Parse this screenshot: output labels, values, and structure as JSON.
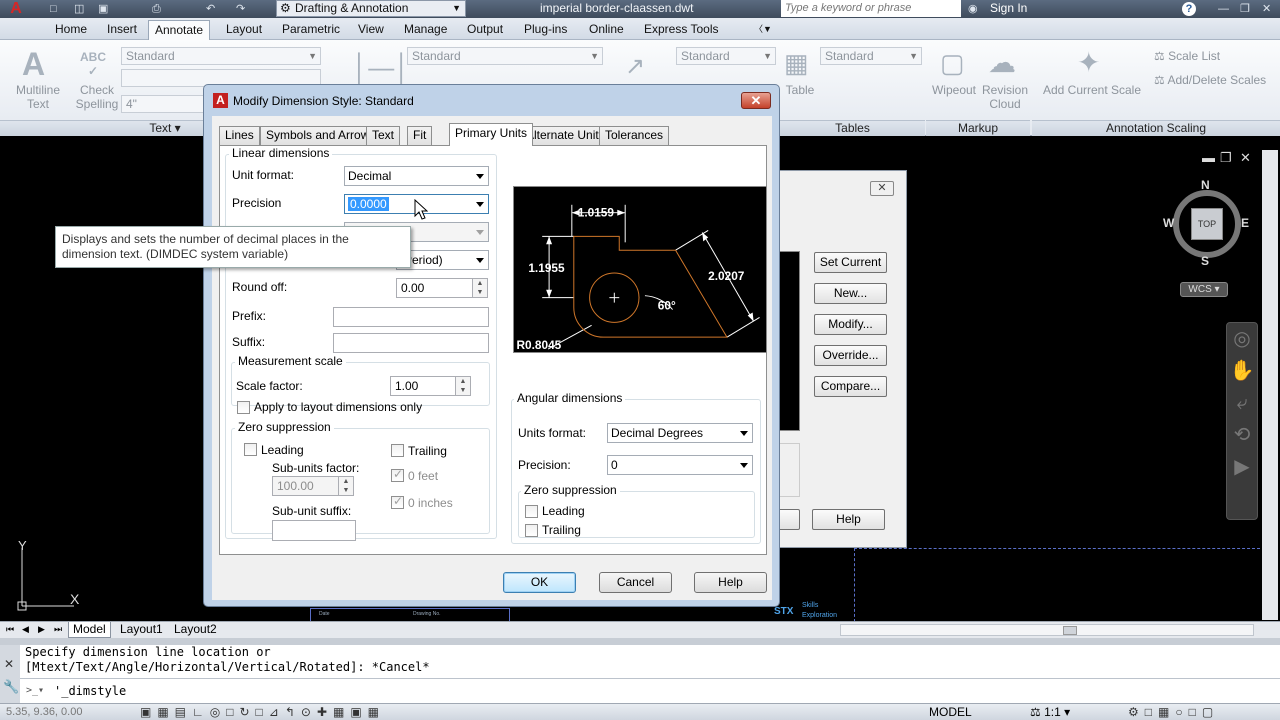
{
  "app": {
    "workspace": "Drafting & Annotation",
    "document_title": "imperial border-claassen.dwt",
    "search_placeholder": "Type a keyword or phrase",
    "sign_in": "Sign In",
    "help_icon": "?"
  },
  "ribbon": {
    "tabs": [
      "Home",
      "Insert",
      "Annotate",
      "Layout",
      "Parametric",
      "View",
      "Manage",
      "Output",
      "Plug-ins",
      "Online",
      "Express Tools"
    ],
    "active_tab": "Annotate",
    "text_panel": {
      "multiline_text": "Multiline Text",
      "check_spelling": "Check Spelling",
      "style_combo": "Standard",
      "height_combo": "4\"",
      "panel_label": "Text"
    },
    "dim_style_combo": "Standard",
    "table_style_combo": "Standard",
    "table_label": "Table",
    "multileader_combo": "Standard",
    "tables_panel": "Tables",
    "wipeout": "Wipeout",
    "revision_cloud": "Revision Cloud",
    "markup_panel": "Markup",
    "add_current_scale": "Add Current Scale",
    "scale_list": "Scale List",
    "add_delete_scales": "Add/Delete Scales",
    "annotation_scaling_panel": "Annotation Scaling"
  },
  "viewcube": {
    "top": "TOP",
    "n": "N",
    "s": "S",
    "e": "E",
    "w": "W",
    "wcs": "WCS"
  },
  "bg_dialog": {
    "buttons": [
      "Set Current",
      "New...",
      "Modify...",
      "Override...",
      "Compare..."
    ],
    "help": "Help"
  },
  "dialog": {
    "title": "Modify Dimension Style: Standard",
    "tabs": [
      "Lines",
      "Symbols and Arrows",
      "Text",
      "Fit",
      "Primary Units",
      "Alternate Units",
      "Tolerances"
    ],
    "active_tab": "Primary Units",
    "linear": {
      "group": "Linear dimensions",
      "unit_format_label": "Unit format:",
      "unit_format": "Decimal",
      "precision_label": "Precision",
      "precision": "0.0000",
      "decimal_sep_partial": "(Period)",
      "round_off_label": "Round off:",
      "round_off": "0.00",
      "prefix_label": "Prefix:",
      "suffix_label": "Suffix:"
    },
    "measurement": {
      "group": "Measurement scale",
      "scale_factor_label": "Scale factor:",
      "scale_factor": "1.00",
      "apply_layout": "Apply to layout dimensions only"
    },
    "zero": {
      "group": "Zero suppression",
      "leading": "Leading",
      "trailing": "Trailing",
      "sub_units_factor_label": "Sub-units factor:",
      "sub_units_factor": "100.00",
      "feet": "0 feet",
      "inches": "0 inches",
      "sub_unit_suffix_label": "Sub-unit suffix:"
    },
    "preview": {
      "dim_top": "1.0159",
      "dim_left": "1.1955",
      "dim_right": "2.0207",
      "angle": "60°",
      "radius": "R0.8045"
    },
    "angular": {
      "group": "Angular dimensions",
      "units_format_label": "Units format:",
      "units_format": "Decimal Degrees",
      "precision_label": "Precision:",
      "precision": "0",
      "zero_group": "Zero suppression",
      "leading": "Leading",
      "trailing": "Trailing"
    },
    "ok": "OK",
    "cancel": "Cancel",
    "help": "Help"
  },
  "tooltip": {
    "text": "Displays and sets the number of decimal places in the dimension text. (DIMDEC system variable)"
  },
  "layout_tabs": [
    "Model",
    "Layout1",
    "Layout2"
  ],
  "title_block": {
    "date": "Date",
    "drawing_no": "Drawing No.",
    "logo": "STX",
    "logo_text1": "Skills",
    "logo_text2": "Exploration"
  },
  "command": {
    "line1": "Specify dimension line location or",
    "line2": "[Mtext/Text/Angle/Horizontal/Vertical/Rotated]: *Cancel*",
    "input": "'_dimstyle"
  },
  "status": {
    "coords": "5.35, 9.36, 0.00",
    "model": "MODEL",
    "scale": "1:1"
  }
}
